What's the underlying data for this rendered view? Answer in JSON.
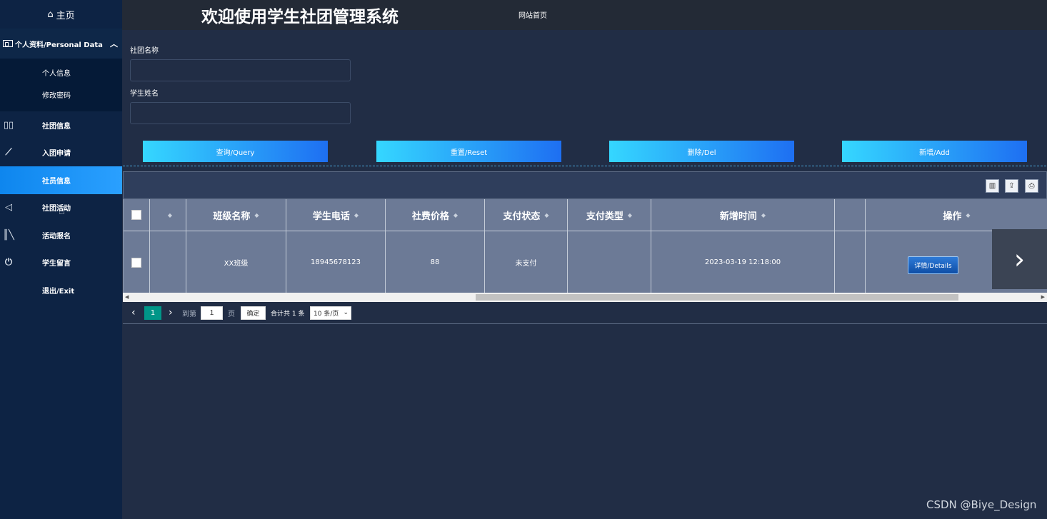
{
  "sidebar": {
    "home": "主页",
    "group": "个人资料/Personal Data",
    "sub_items": [
      "个人信息",
      "修改密码"
    ],
    "items": [
      {
        "label": "社团信息",
        "icon": "book-icon"
      },
      {
        "label": "入团申请",
        "icon": "ruler-icon"
      },
      {
        "label": "社员信息",
        "icon": "",
        "active": true
      },
      {
        "label": "社团活动",
        "icon": "send-icon"
      },
      {
        "label": "活动报名",
        "icon": "library-icon"
      },
      {
        "label": "学生留言",
        "icon": "power-icon"
      },
      {
        "label": "退出/Exit",
        "icon": ""
      }
    ]
  },
  "header": {
    "title": "欢迎使用学生社团管理系统",
    "link": "网站首页"
  },
  "search": {
    "club_label": "社团名称",
    "student_label": "学生姓名",
    "club_value": "",
    "student_value": ""
  },
  "buttons": {
    "query": "查询/Query",
    "reset": "重置/Reset",
    "delete": "删除/Del",
    "add": "新增/Add"
  },
  "table": {
    "columns": [
      "班级名称",
      "学生电话",
      "社费价格",
      "支付状态",
      "支付类型",
      "新增时间",
      "操作"
    ],
    "rows": [
      {
        "class_name": "XX班级",
        "phone": "18945678123",
        "fee": "88",
        "status": "未支付",
        "pay_type": "",
        "created": "2023-03-19 12:18:00",
        "action": "详情/Details"
      }
    ]
  },
  "pager": {
    "current_page": "1",
    "goto_label": "到第",
    "page_input": "1",
    "page_unit": "页",
    "confirm": "确定",
    "total": "合计共 1 条",
    "page_size": "10 条/页"
  },
  "watermark": "CSDN @Biye_Design"
}
